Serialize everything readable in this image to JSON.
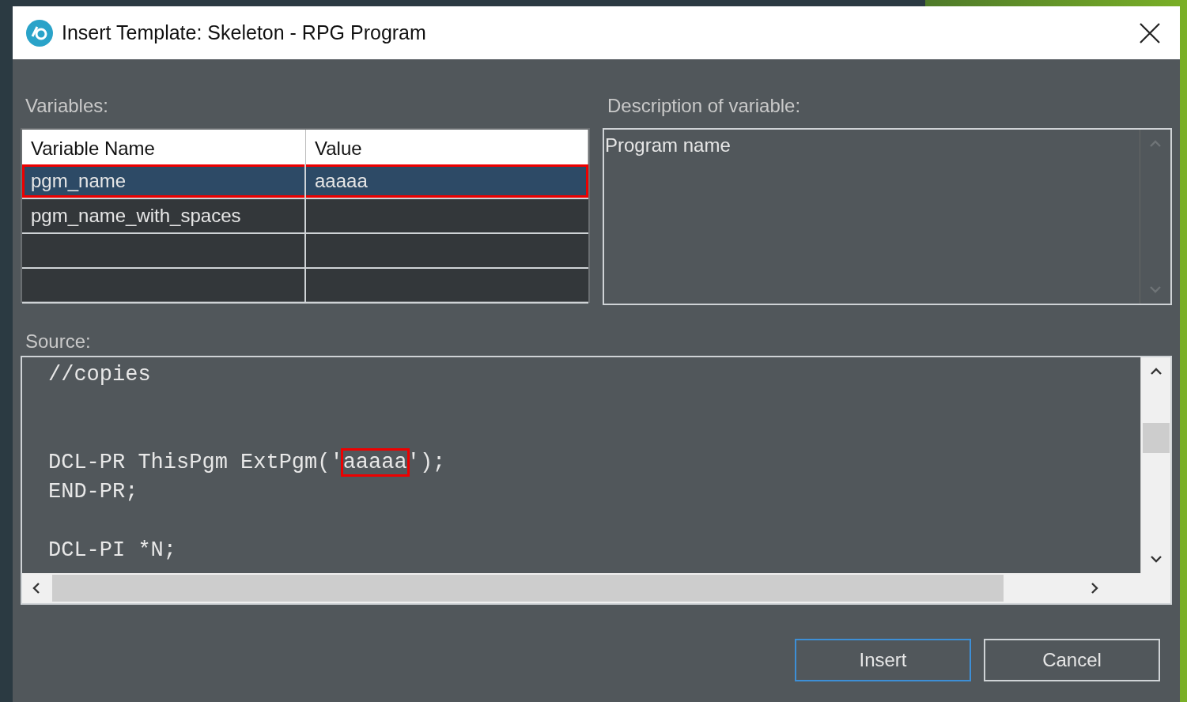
{
  "window": {
    "title": "Insert Template: Skeleton - RPG Program"
  },
  "variables": {
    "label": "Variables:",
    "columns": [
      "Variable Name",
      "Value"
    ],
    "rows": [
      {
        "name": "pgm_name",
        "value": "aaaaa",
        "selected": true,
        "highlighted": true
      },
      {
        "name": "pgm_name_with_spaces",
        "selected": false,
        "highlighted": false
      },
      {
        "selected": false,
        "highlighted": false
      },
      {
        "selected": false,
        "highlighted": false
      }
    ]
  },
  "description": {
    "label": "Description of variable:",
    "text": "Program name"
  },
  "source": {
    "label": "Source:",
    "lines": [
      {
        "kind": "code",
        "parts": [
          {
            "text": "//copies",
            "highlighted": false
          }
        ]
      },
      {
        "kind": "blank"
      },
      {
        "kind": "blank"
      },
      {
        "kind": "code",
        "parts": [
          {
            "text": "DCL-PR ThisPgm ExtPgm('",
            "highlighted": false
          },
          {
            "text": "aaaaa",
            "highlighted": true
          },
          {
            "text": "');",
            "highlighted": false
          }
        ]
      },
      {
        "kind": "code",
        "parts": [
          {
            "text": "END-PR;",
            "highlighted": false
          }
        ]
      },
      {
        "kind": "blank"
      },
      {
        "kind": "code",
        "parts": [
          {
            "text": "DCL-PI *N;",
            "highlighted": false
          }
        ]
      }
    ]
  },
  "buttons": [
    {
      "label": "Insert",
      "default": true
    },
    {
      "label": "Cancel",
      "default": false
    }
  ]
}
